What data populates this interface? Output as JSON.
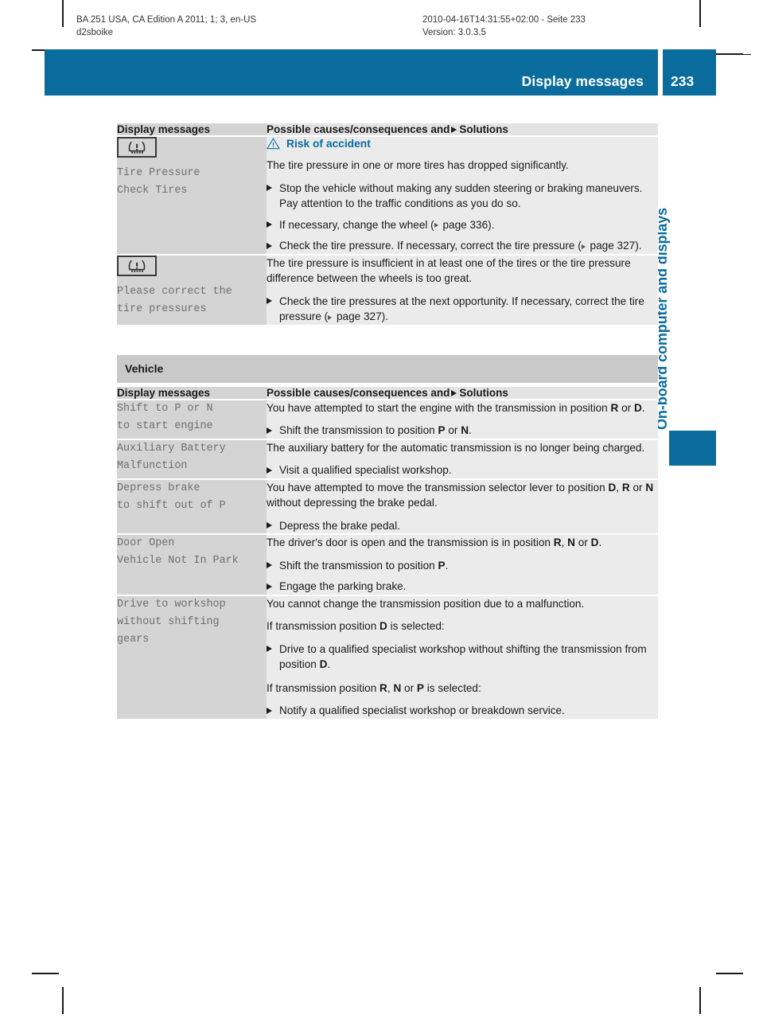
{
  "print_meta": {
    "left_line1": "BA 251 USA, CA Edition A 2011; 1; 3, en-US",
    "left_line2": "d2sboike",
    "right_line1": "2010-04-16T14:31:55+02:00 - Seite 233",
    "right_line2": "Version: 3.0.3.5"
  },
  "banner": {
    "title": "Display messages",
    "page_number": "233",
    "color": "#0a6c9c"
  },
  "side_tab": {
    "label": "On-board computer and displays",
    "color": "#0a6c9c"
  },
  "colors": {
    "accent_blue": "#0a6c9c",
    "header_gray": "#d4d4d4",
    "section_gray": "#c9c9c9",
    "cell_left_gray": "#d4d4d4",
    "cell_right_gray": "#ebebeb",
    "message_text_gray": "#6f6f6f"
  },
  "table_headers": {
    "col1": "Display messages",
    "col2_pre": "Possible causes/consequences and",
    "col2_post": "Solutions"
  },
  "tire_table": {
    "rows": [
      {
        "icon": "tire-pressure-warning-icon",
        "message": "Tire Pressure\nCheck Tires",
        "warning": {
          "icon": "warning-triangle-icon",
          "label": "Risk of accident"
        },
        "paragraphs": [
          "The tire pressure in one or more tires has dropped significantly."
        ],
        "bullets": [
          "Stop the vehicle without making any sudden steering or braking maneuvers. Pay attention to the traffic conditions as you do so.",
          "If necessary, change the wheel (▷ page 336).",
          "Check the tire pressure. If necessary, correct the tire pressure (▷ page 327)."
        ]
      },
      {
        "icon": "tire-pressure-warning-icon",
        "message": "Please correct the\ntire pressures",
        "paragraphs": [
          "The tire pressure is insufficient in at least one of the tires or the tire pressure difference between the wheels is too great."
        ],
        "bullets": [
          "Check the tire pressures at the next opportunity. If necessary, correct the tire pressure (▷ page 327)."
        ]
      }
    ]
  },
  "vehicle_section": {
    "heading": "Vehicle",
    "rows": [
      {
        "message": "Shift to P or N\nto start engine",
        "paragraphs": [
          "You have attempted to start the engine with the transmission in position R or D."
        ],
        "bullets": [
          "Shift the transmission to position P or N."
        ]
      },
      {
        "message": "Auxiliary Battery\nMalfunction",
        "paragraphs": [
          "The auxiliary battery for the automatic transmission is no longer being charged."
        ],
        "bullets": [
          "Visit a qualified specialist workshop."
        ]
      },
      {
        "message": "Depress brake\nto shift out of P",
        "paragraphs": [
          "You have attempted to move the transmission selector lever to position D, R or N without depressing the brake pedal."
        ],
        "bullets": [
          "Depress the brake pedal."
        ]
      },
      {
        "message": "Door Open\nVehicle Not In Park",
        "paragraphs": [
          "The driver's door is open and the transmission is in position R, N or D."
        ],
        "bullets": [
          "Shift the transmission to position P.",
          "Engage the parking brake."
        ]
      },
      {
        "message": "Drive to workshop\nwithout shifting\ngears",
        "paragraphs": [
          "You cannot change the transmission position due to a malfunction.",
          "If transmission position D is selected:"
        ],
        "bullets_1": [
          "Drive to a qualified specialist workshop without shifting the transmission from position D."
        ],
        "paragraph_2": "If transmission position R, N or P is selected:",
        "bullets_2": [
          "Notify a qualified specialist workshop or breakdown service."
        ]
      }
    ]
  }
}
